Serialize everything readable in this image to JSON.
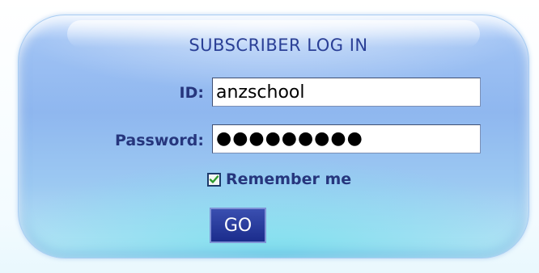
{
  "login": {
    "title": "SUBSCRIBER LOG IN",
    "id_label": "ID:",
    "id_value": "anzschool",
    "password_label": "Password:",
    "password_masked": "●●●●●●●●●",
    "remember_label": "Remember me",
    "remember_checked": true,
    "go_label": "GO"
  },
  "icons": {
    "checkbox_check": "checkmark-icon"
  },
  "colors": {
    "title_text": "#2a3f96",
    "label_text": "#26367d",
    "button_bg": "#1b2c8c",
    "check_green": "#2e9b2e",
    "panel_blue": "#8fb7ef",
    "panel_cyan": "#7fe0ee"
  }
}
